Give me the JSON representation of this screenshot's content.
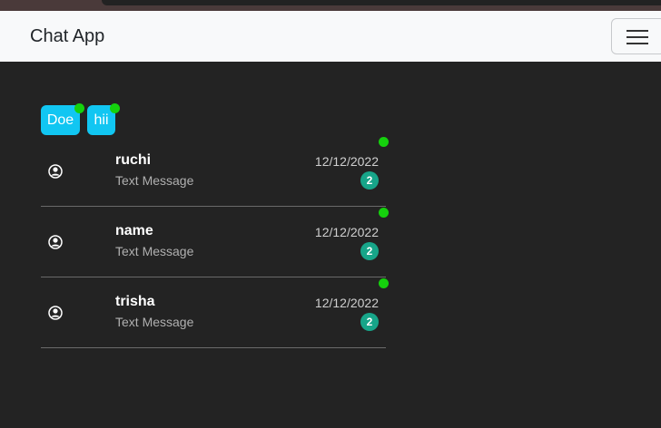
{
  "navbar": {
    "brand": "Chat App",
    "toggle_icon": "hamburger-menu-icon"
  },
  "active_chips": [
    {
      "label": "Doe",
      "online": true
    },
    {
      "label": "hii",
      "online": true
    }
  ],
  "chats": [
    {
      "name": "ruchi",
      "message": "Text Message",
      "date": "12/12/2022",
      "unread": "2",
      "online": true,
      "icon": "user-circle-icon"
    },
    {
      "name": "name",
      "message": "Text Message",
      "date": "12/12/2022",
      "unread": "2",
      "online": true,
      "icon": "user-circle-icon"
    },
    {
      "name": "trisha",
      "message": "Text Message",
      "date": "12/12/2022",
      "unread": "2",
      "online": true,
      "icon": "user-circle-icon"
    }
  ],
  "colors": {
    "background": "#232323",
    "chip": "#11c6f2",
    "online": "#15d10d",
    "badge": "#17a589"
  }
}
